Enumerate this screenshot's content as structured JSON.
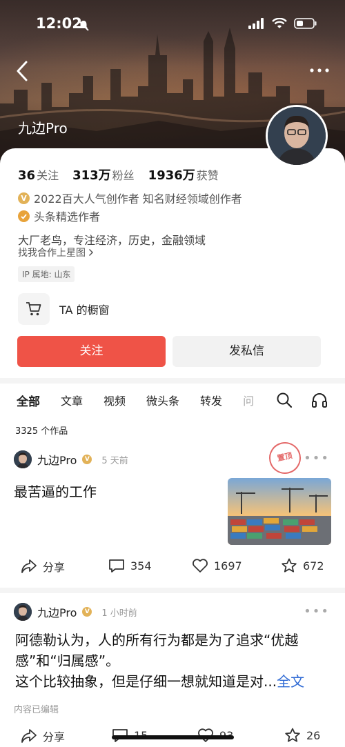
{
  "status_bar": {
    "time": "12:02"
  },
  "profile": {
    "name": "九边Pro",
    "stats": [
      {
        "num": "36",
        "label": "关注"
      },
      {
        "num": "313万",
        "label": "粉丝"
      },
      {
        "num": "1936万",
        "label": "获赞"
      }
    ],
    "cert_main": "2022百大人气创作者 知名财经领域创作者",
    "cert_second": "头条精选作者",
    "bio": "大厂老鸟，专注经济，历史，金融领域",
    "coop": "找我合作上星图",
    "ip": "IP 属地: 山东",
    "shop_label": "TA 的橱窗",
    "follow_label": "关注",
    "message_label": "发私信"
  },
  "tabs": [
    "全部",
    "文章",
    "视频",
    "微头条",
    "转发",
    "问"
  ],
  "works_count": "3325 个作品",
  "posts": [
    {
      "author": "九边Pro",
      "time": "5 天前",
      "title": "最苦逼的工作",
      "stamp": "置顶",
      "share": "分享",
      "comments": "354",
      "likes": "1697",
      "favorites": "672"
    },
    {
      "author": "九边Pro",
      "time": "1 小时前",
      "line1": "阿德勒认为，人的所有行为都是为了追求“优越",
      "line2": "感”和“归属感”。",
      "line3": "这个比较抽象，但是仔细一想就知道是对...",
      "more": "全文",
      "edited": "内容已编辑",
      "share": "分享",
      "comments": "15",
      "likes": "93",
      "favorites": "26"
    }
  ],
  "colors": {
    "accent": "#ef5347",
    "link": "#2f6ad4",
    "badge": "#e2b258"
  }
}
